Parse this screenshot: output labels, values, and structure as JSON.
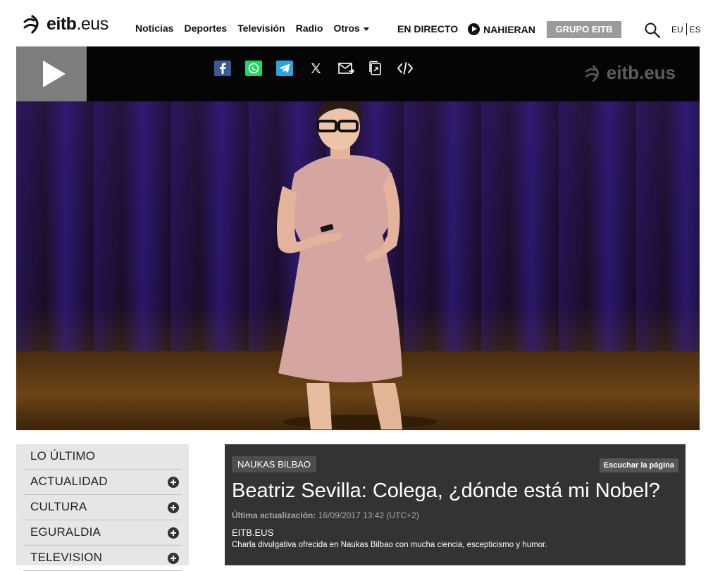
{
  "header": {
    "logo_text": "eitb",
    "logo_suffix": ".eus",
    "nav": [
      "Noticias",
      "Deportes",
      "Televisión",
      "Radio",
      "Otros"
    ],
    "live_label": "EN DIRECTO",
    "nahieran_label": "NAHIERAN",
    "grupo_label": "GRUPO EITB",
    "lang_eu": "EU",
    "lang_es": "ES"
  },
  "video": {
    "watermark": ".eus",
    "watermark_brand": "eitb",
    "share_icons": [
      "facebook-icon",
      "whatsapp-icon",
      "telegram-icon",
      "x-icon",
      "mail-icon",
      "copy-link-icon",
      "embed-icon"
    ],
    "colors": {
      "facebook": "#3b5998",
      "whatsapp": "#25d366",
      "telegram": "#2aa3df"
    }
  },
  "sidebar": {
    "items": [
      {
        "label": "LO ÚLTIMO",
        "expandable": false
      },
      {
        "label": "ACTUALIDAD",
        "expandable": true
      },
      {
        "label": "CULTURA",
        "expandable": true
      },
      {
        "label": "EGURALDIA",
        "expandable": true
      },
      {
        "label": "TELEVISION",
        "expandable": true
      }
    ]
  },
  "article": {
    "section": "NAUKAS BILBAO",
    "listen_label": "Escuchar la página",
    "title": "Beatriz Sevilla: Colega, ¿dónde está mi Nobel?",
    "updated_label": "Última actualización:",
    "updated_value": "16/09/2017 13:42 (UTC+2)",
    "source": "EITB.EUS",
    "description": "Charla divulgativa ofrecida en Naukas Bilbao con mucha ciencia, escepticismo y humor."
  }
}
